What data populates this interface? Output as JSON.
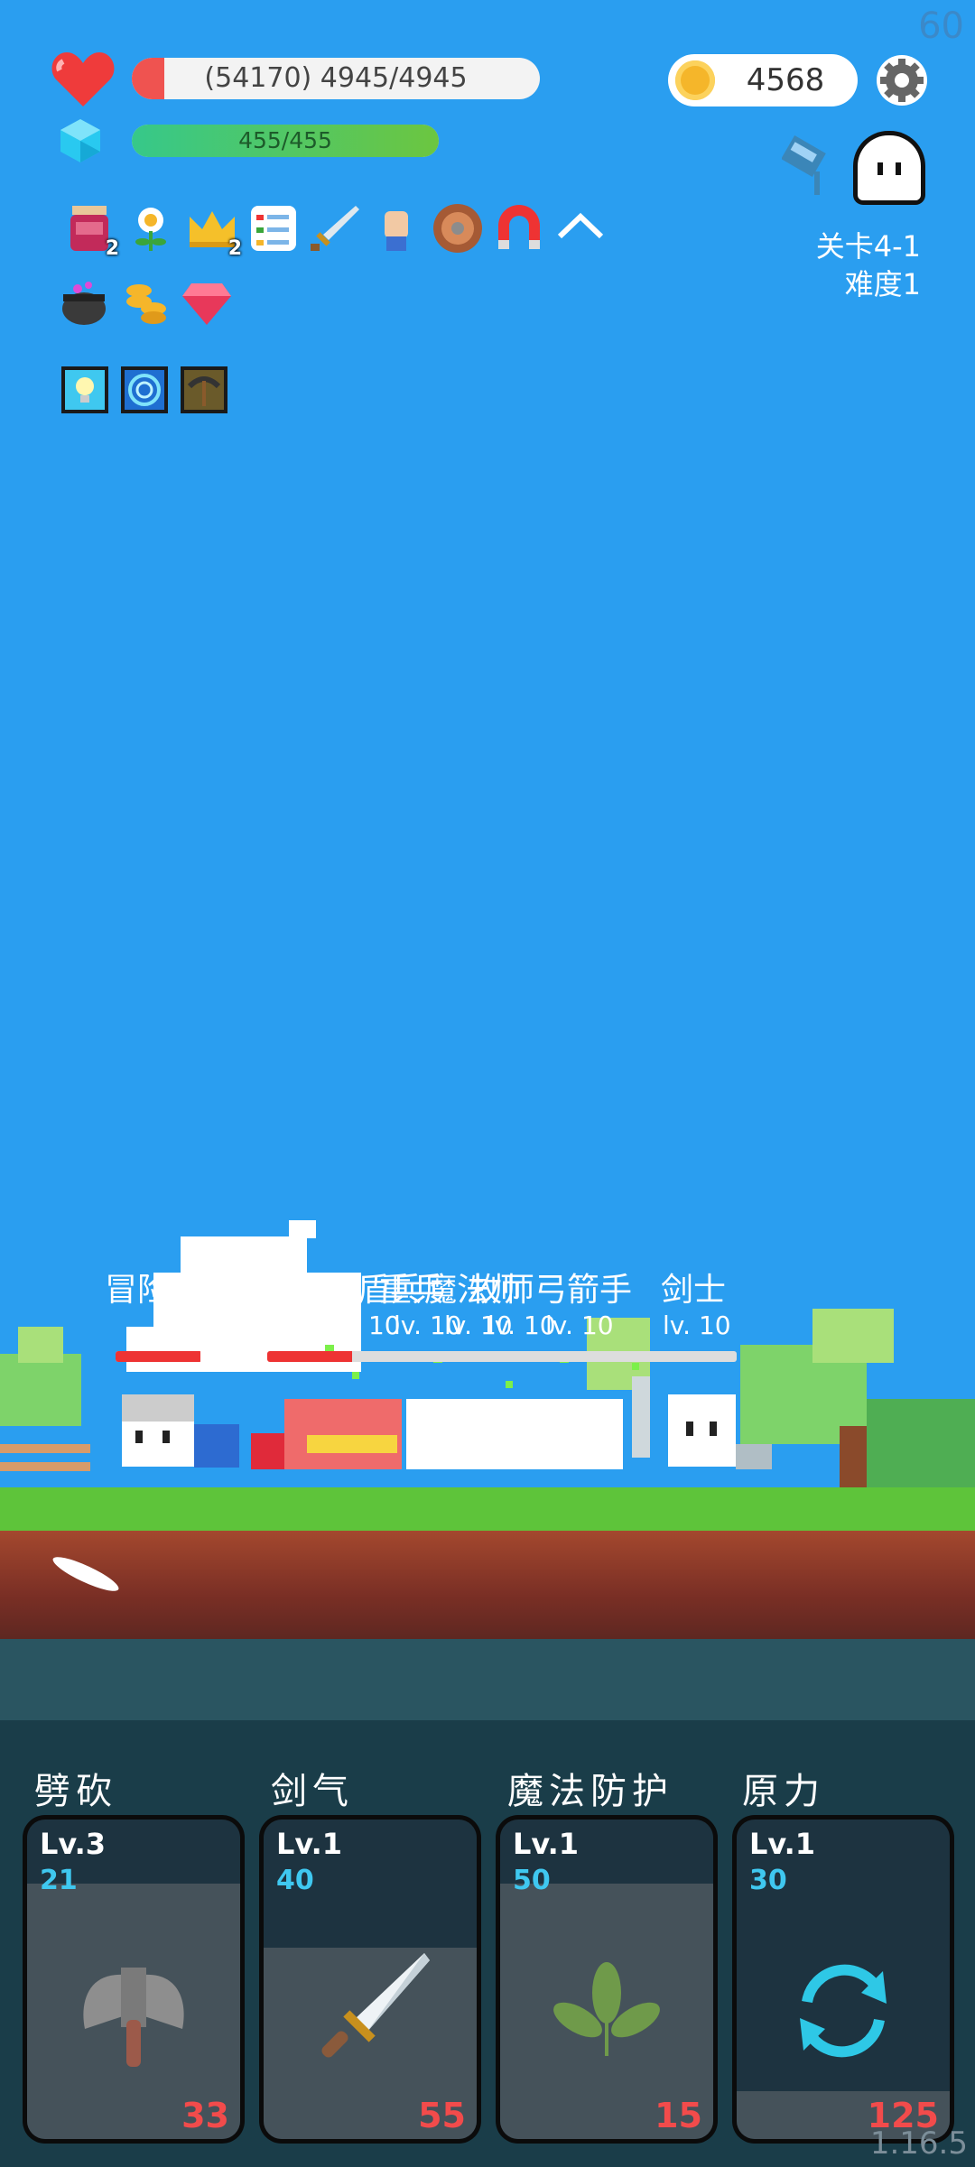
{
  "fps": "60",
  "version": "1.16.5",
  "hp": {
    "text": "(54170) 4945/4945",
    "fill_fraction": 0.08,
    "icon": "heart-icon"
  },
  "mp": {
    "text": "455/455",
    "fill_fraction": 1.0,
    "icon": "gem-icon"
  },
  "gold": {
    "value": "4568",
    "icon": "coin-icon"
  },
  "stage": {
    "level": "关卡4-1",
    "difficulty": "难度1"
  },
  "buffs": [
    {
      "icon": "jam-jar-icon",
      "count": "2"
    },
    {
      "icon": "flower-icon",
      "count": ""
    },
    {
      "icon": "crown-icon",
      "count": "2"
    },
    {
      "icon": "checklist-icon",
      "count": ""
    },
    {
      "icon": "sword-icon",
      "count": ""
    },
    {
      "icon": "fist-icon",
      "count": ""
    },
    {
      "icon": "round-shield-icon",
      "count": ""
    },
    {
      "icon": "magnet-icon",
      "count": ""
    },
    {
      "icon": "collapse-chevron-icon",
      "count": ""
    },
    {
      "icon": "cauldron-icon",
      "count": ""
    },
    {
      "icon": "coin-stack-icon",
      "count": ""
    },
    {
      "icon": "ruby-icon",
      "count": ""
    }
  ],
  "item_slots": [
    "lightbulb-slot-icon",
    "portal-slot-icon",
    "pickaxe-slot-icon"
  ],
  "battle": {
    "hero": {
      "name": "冒险",
      "hp_fraction": 0.98
    },
    "enemies": [
      {
        "name": "盾兵",
        "level": "lv. 10"
      },
      {
        "name": "剑盾兵",
        "level": "lv. 10"
      },
      {
        "name": "重兵",
        "level": "lv. 10"
      },
      {
        "name": "魔法师",
        "level": "lv. 10"
      },
      {
        "name": "牧师",
        "level": "lv. 10"
      },
      {
        "name": "弓箭手",
        "level": "lv. 10"
      },
      {
        "name": "剑士",
        "level": "lv. 10"
      }
    ]
  },
  "skills": [
    {
      "name": "劈砍",
      "level": "Lv.3",
      "cost": "21",
      "cooldown": "33",
      "icon": "axe-icon",
      "cd_fraction": 0.8
    },
    {
      "name": "剑气",
      "level": "Lv.1",
      "cost": "40",
      "cooldown": "55",
      "icon": "sword-icon",
      "cd_fraction": 0.6
    },
    {
      "name": "魔法防护",
      "level": "Lv.1",
      "cost": "50",
      "cooldown": "15",
      "icon": "leaf-icon",
      "cd_fraction": 0.8
    },
    {
      "name": "原力",
      "level": "Lv.1",
      "cost": "30",
      "cooldown": "125",
      "icon": "refresh-cycle-icon",
      "cd_fraction": 0.15
    }
  ]
}
